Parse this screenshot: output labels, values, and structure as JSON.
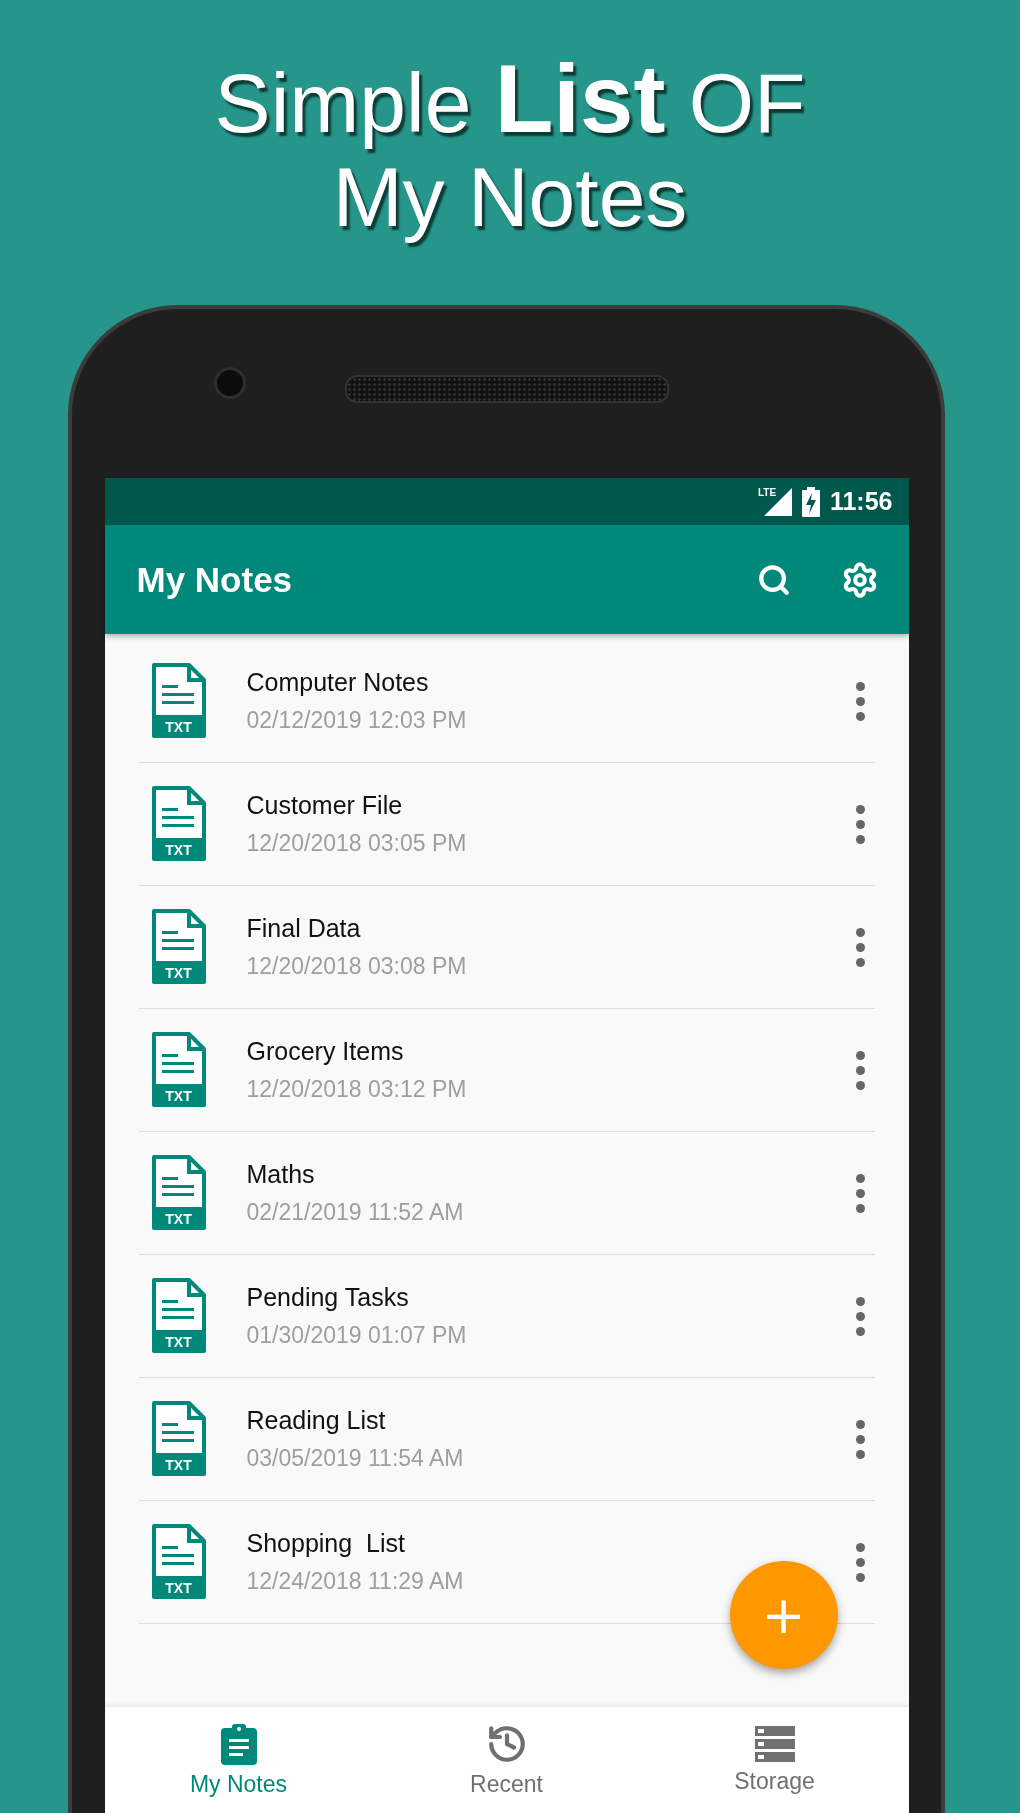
{
  "headline": {
    "line_1": "Simple **List** OF",
    "line_2": "My Notes"
  },
  "status_bar": {
    "network": "LTE",
    "charging": true,
    "time": "11:56"
  },
  "app_bar": {
    "title": "My Notes"
  },
  "notes": [
    {
      "title": "Computer Notes",
      "date": "02/12/2019 12:03 PM",
      "file_type": "TXT"
    },
    {
      "title": "Customer File",
      "date": "12/20/2018 03:05 PM",
      "file_type": "TXT"
    },
    {
      "title": "Final Data",
      "date": "12/20/2018 03:08 PM",
      "file_type": "TXT"
    },
    {
      "title": "Grocery Items",
      "date": "12/20/2018 03:12 PM",
      "file_type": "TXT"
    },
    {
      "title": "Maths",
      "date": "02/21/2019 11:52 AM",
      "file_type": "TXT"
    },
    {
      "title": "Pending Tasks",
      "date": "01/30/2019 01:07 PM",
      "file_type": "TXT"
    },
    {
      "title": "Reading List",
      "date": "03/05/2019 11:54 AM",
      "file_type": "TXT"
    },
    {
      "title": "Shopping  List",
      "date": "12/24/2018 11:29 AM",
      "file_type": "TXT"
    }
  ],
  "fab": {
    "label": "+"
  },
  "bottom_nav": [
    {
      "label": "My Notes",
      "kind": "clipboard",
      "selected": true
    },
    {
      "label": "Recent",
      "kind": "history",
      "selected": false
    },
    {
      "label": "Storage",
      "kind": "storage",
      "selected": false
    }
  ]
}
